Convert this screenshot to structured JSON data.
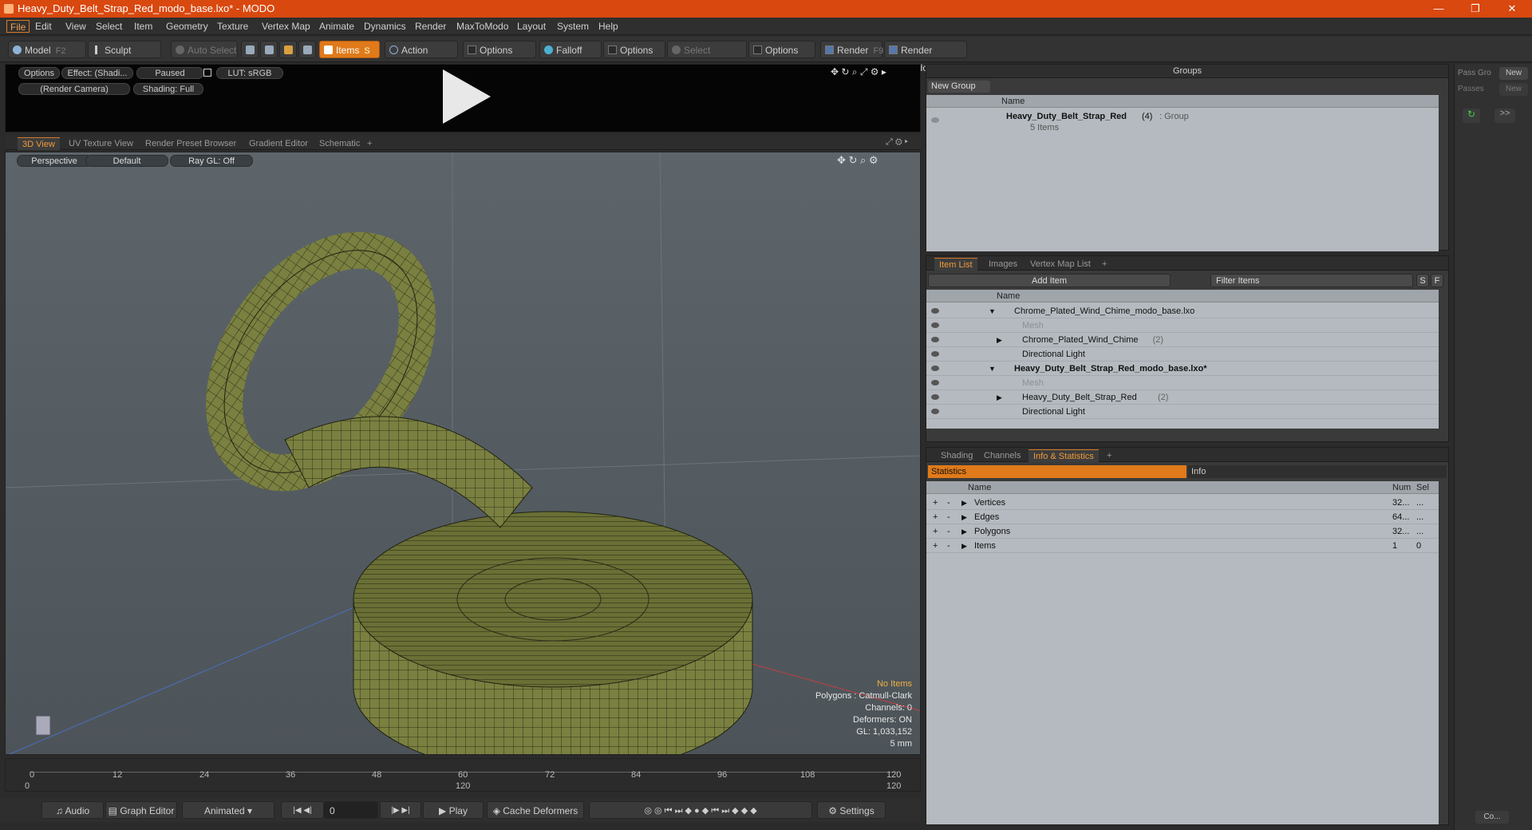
{
  "window": {
    "title": "Heavy_Duty_Belt_Strap_Red_modo_base.lxo* - MODO",
    "min": "—",
    "max": "❐",
    "close": "✕"
  },
  "menu": [
    "File",
    "Edit",
    "View",
    "Select",
    "Item",
    "Geometry",
    "Texture",
    "Vertex Map",
    "Animate",
    "Dynamics",
    "Render",
    "MaxToModo",
    "Layout",
    "System",
    "Help"
  ],
  "toolbar": {
    "model": "Model",
    "model_key": "F2",
    "sculpt": "Sculpt",
    "auto_select": "Auto Select",
    "items": "Items",
    "items_key": "S",
    "action_center": "Action Center",
    "options1": "Options",
    "falloff": "Falloff",
    "options2": "Options",
    "select_through": "Select Through",
    "options3": "Options",
    "render": "Render",
    "render_key": "F9",
    "render_window": "Render Window"
  },
  "preview": {
    "options": "Options",
    "effect": "Effect: (Shadi...",
    "paused": "Paused",
    "lut": "LUT: sRGB",
    "camera": "(Render Camera)",
    "shading": "Shading: Full"
  },
  "viewport_tabs": [
    "3D View",
    "UV Texture View",
    "Render Preset Browser",
    "Gradient Editor",
    "Schematic",
    "+"
  ],
  "viewport": {
    "perspective": "Perspective",
    "default": "Default",
    "raygl": "Ray GL: Off",
    "no_items": "No Items",
    "stats": [
      "Polygons : Catmull-Clark",
      "Channels: 0",
      "Deformers: ON",
      "GL: 1,033,152",
      "5 mm"
    ]
  },
  "timeline": {
    "ticks": [
      "0",
      "12",
      "24",
      "36",
      "48",
      "60",
      "72",
      "84",
      "96",
      "108",
      "120"
    ],
    "lower": [
      "0",
      "120",
      "120"
    ]
  },
  "transport": {
    "audio": "Audio",
    "graph_editor": "Graph Editor",
    "animated": "Animated",
    "frame": "0",
    "play": "Play",
    "cache": "Cache Deformers",
    "settings": "Settings"
  },
  "groups": {
    "title": "Groups",
    "new_group": "New Group",
    "col_name": "Name",
    "item_name": "Heavy_Duty_Belt_Strap_Red",
    "item_count": "(4)",
    "item_type": ": Group",
    "item_sub": "5 Items"
  },
  "itemlist": {
    "tabs": [
      "Item List",
      "Images",
      "Vertex Map List",
      "+"
    ],
    "add_item": "Add Item",
    "filter": "Filter Items",
    "s": "S",
    "f": "F",
    "col_name": "Name",
    "rows": [
      {
        "label": "Chrome_Plated_Wind_Chime_modo_base.lxo",
        "count": "",
        "bold": false,
        "indent": 0
      },
      {
        "label": "Mesh",
        "count": "",
        "bold": false,
        "indent": 1
      },
      {
        "label": "Chrome_Plated_Wind_Chime",
        "count": "(2)",
        "bold": false,
        "indent": 1
      },
      {
        "label": "Directional Light",
        "count": "",
        "bold": false,
        "indent": 1
      },
      {
        "label": "Heavy_Duty_Belt_Strap_Red_modo_base.lxo*",
        "count": "",
        "bold": true,
        "indent": 0
      },
      {
        "label": "Mesh",
        "count": "",
        "bold": false,
        "indent": 1
      },
      {
        "label": "Heavy_Duty_Belt_Strap_Red",
        "count": "(2)",
        "bold": false,
        "indent": 1
      },
      {
        "label": "Directional Light",
        "count": "",
        "bold": false,
        "indent": 1
      }
    ]
  },
  "info": {
    "tabs": [
      "Shading",
      "Channels",
      "Info & Statistics",
      "+"
    ],
    "statistics": "Statistics",
    "info": "Info",
    "cols": {
      "name": "Name",
      "num": "Num",
      "sel": "Sel"
    },
    "rows": [
      {
        "name": "Vertices",
        "num": "32...",
        "sel": "..."
      },
      {
        "name": "Edges",
        "num": "64...",
        "sel": "..."
      },
      {
        "name": "Polygons",
        "num": "32...",
        "sel": "..."
      },
      {
        "name": "Items",
        "num": "1",
        "sel": "0"
      }
    ]
  },
  "rightbar": {
    "pass_group": "Pass Gro",
    "new1": "New",
    "passes": "Passes",
    "new2": "New",
    "co": "Co..."
  },
  "colors": {
    "accent": "#e07a1a",
    "title": "#d9480f",
    "mesh": "#7a8040"
  }
}
